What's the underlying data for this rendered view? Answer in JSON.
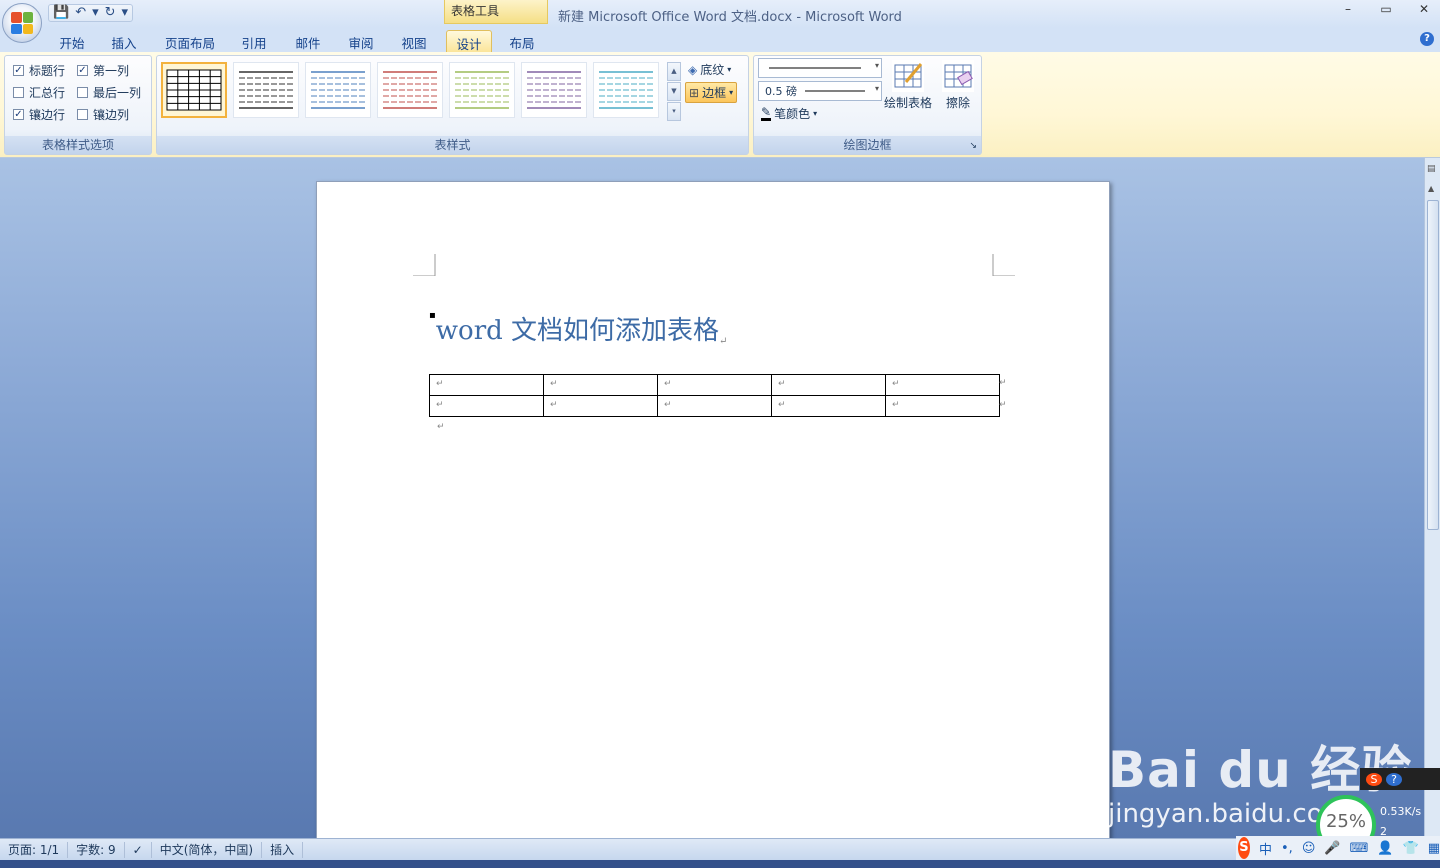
{
  "window": {
    "title": "新建 Microsoft Office Word 文档.docx - Microsoft Word",
    "context_tab_title": "表格工具",
    "controls": [
      "–",
      "▭",
      "✕"
    ]
  },
  "qat": {
    "save": "💾",
    "undo": "↶",
    "undo_dd": "▾",
    "redo": "↻",
    "customize": "▾"
  },
  "tabs": [
    {
      "label": "开始"
    },
    {
      "label": "插入"
    },
    {
      "label": "页面布局"
    },
    {
      "label": "引用"
    },
    {
      "label": "邮件"
    },
    {
      "label": "审阅"
    },
    {
      "label": "视图"
    },
    {
      "label": "设计"
    },
    {
      "label": "布局"
    }
  ],
  "help": "?",
  "ribbon": {
    "options_group": {
      "label": "表格样式选项",
      "items": [
        {
          "label": "标题行",
          "checked": "✓"
        },
        {
          "label": "第一列",
          "checked": "✓"
        },
        {
          "label": "汇总行",
          "checked": ""
        },
        {
          "label": "最后一列",
          "checked": ""
        },
        {
          "label": "镶边行",
          "checked": "✓"
        },
        {
          "label": "镶边列",
          "checked": ""
        }
      ]
    },
    "styles_group": {
      "label": "表样式",
      "shading": "底纹",
      "borders": "边框",
      "scroll": [
        "▲",
        "▼",
        "▾"
      ],
      "thumb_colors": [
        "#000000",
        "#333333",
        "#4f81bd",
        "#c0504d",
        "#9bbb59",
        "#8064a2",
        "#4bacc6"
      ]
    },
    "draw_group": {
      "label": "绘图边框",
      "line_weight": "0.5 磅",
      "pen_color": "笔颜色",
      "draw_table": "绘制表格",
      "eraser": "擦除",
      "arrow": "▾",
      "launcher": "↘"
    }
  },
  "document": {
    "title": "word 文档如何添加表格",
    "return_mark": "↵",
    "table_rows": 2,
    "table_cols": 5
  },
  "status": {
    "page": "页面: 1/1",
    "words": "字数: 9",
    "check": "✓",
    "language": "中文(简体，中国)",
    "mode": "插入"
  },
  "overlay": {
    "watermark": "Bai du 经验",
    "watermark_url": "jingyan.baidu.com",
    "ime_items": [
      "S",
      "中",
      "•,",
      "☺",
      "🎤",
      "⌨",
      "👤",
      "👕",
      "▦"
    ],
    "netmon": [
      "S",
      "?"
    ],
    "gauge": "25%",
    "net_speed": "0.53K/s",
    "net_count": "2"
  }
}
